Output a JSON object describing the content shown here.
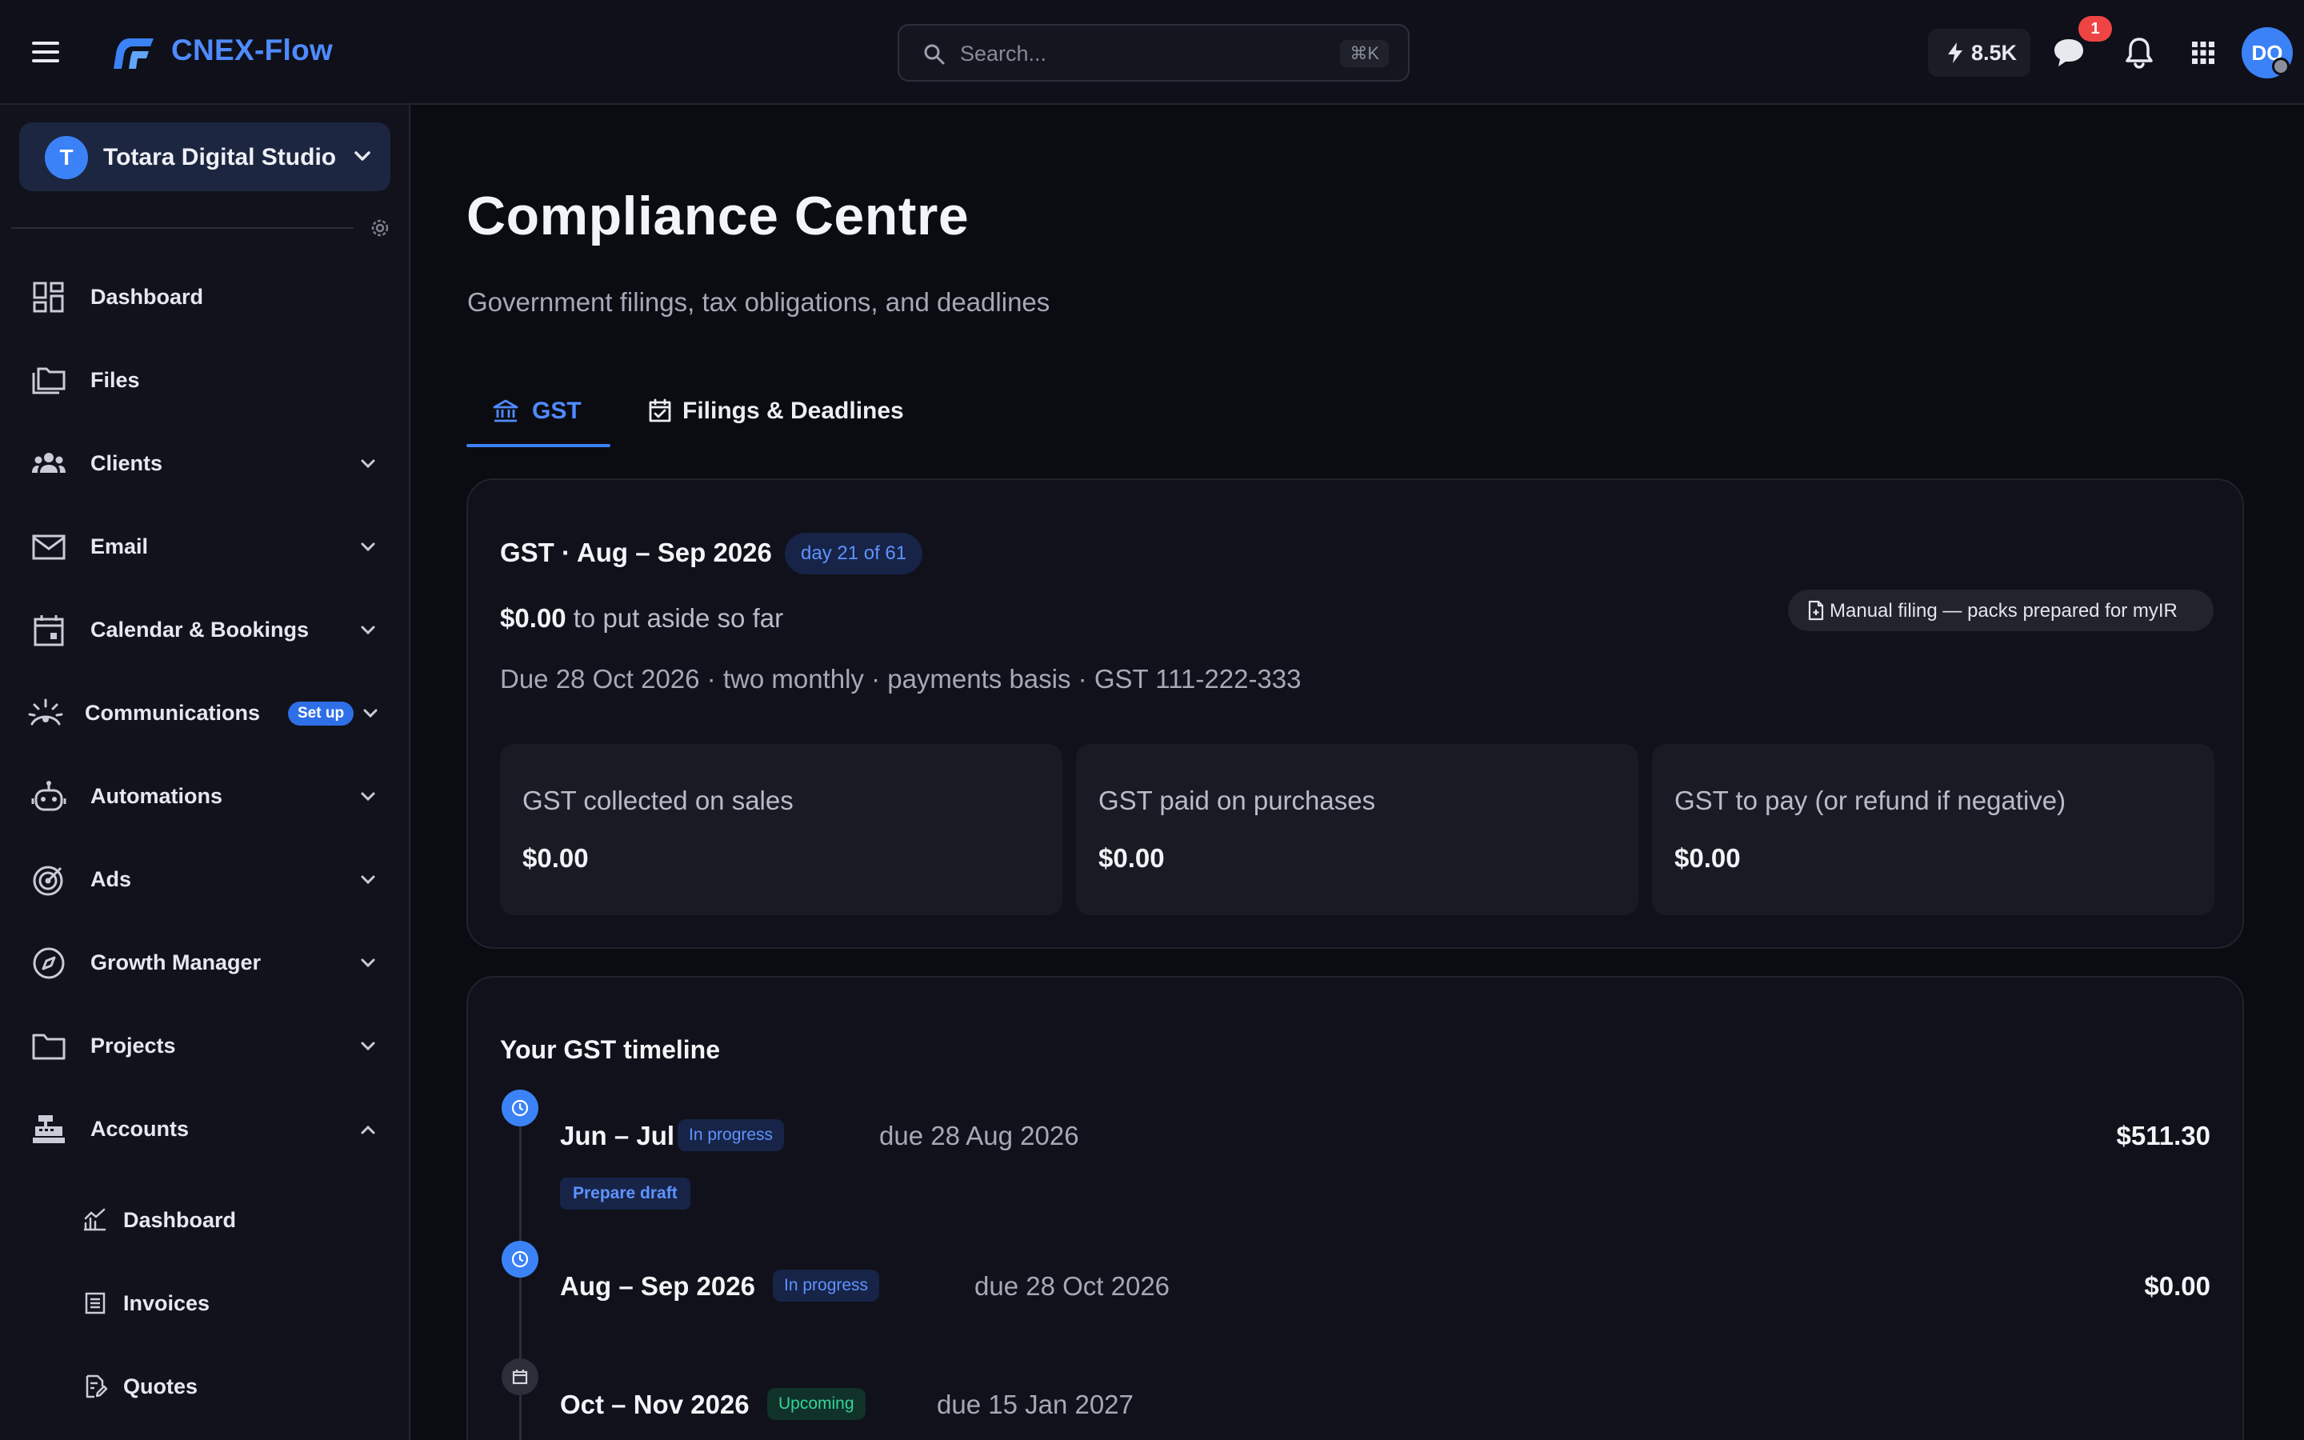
{
  "app": {
    "brand": "CNEX-Flow"
  },
  "topbar": {
    "search_placeholder": "Search...",
    "search_shortcut": "⌘K",
    "credits": "8.5K",
    "messages_badge": "1",
    "avatar_initials": "DO"
  },
  "sidebar": {
    "org_initial": "T",
    "org_name": "Totara Digital Studio",
    "items": [
      {
        "label": "Dashboard",
        "icon": "dashboard-icon"
      },
      {
        "label": "Files",
        "icon": "files-icon"
      },
      {
        "label": "Clients",
        "icon": "clients-icon"
      },
      {
        "label": "Email",
        "icon": "email-icon"
      },
      {
        "label": "Calendar & Bookings",
        "icon": "calendar-icon"
      },
      {
        "label": "Communications",
        "icon": "communications-icon",
        "badge": "Set up"
      },
      {
        "label": "Automations",
        "icon": "robot-icon"
      },
      {
        "label": "Ads",
        "icon": "target-icon"
      },
      {
        "label": "Growth Manager",
        "icon": "compass-icon"
      },
      {
        "label": "Projects",
        "icon": "folder-icon"
      },
      {
        "label": "Accounts",
        "icon": "register-icon"
      }
    ],
    "sub_items": [
      {
        "label": "Dashboard",
        "icon": "chart-icon"
      },
      {
        "label": "Invoices",
        "icon": "invoice-icon"
      },
      {
        "label": "Quotes",
        "icon": "quote-icon"
      }
    ]
  },
  "main": {
    "title": "Compliance Centre",
    "subtitle": "Government filings, tax obligations, and deadlines",
    "tabs": [
      {
        "label": "GST",
        "active": true
      },
      {
        "label": "Filings & Deadlines",
        "active": false
      }
    ],
    "gst_card": {
      "heading": "GST · Aug – Sep 2026",
      "day_badge": "day 21 of 61",
      "aside_amount": "$0.00",
      "aside_text": " to put aside so far",
      "manual_filing": "Manual filing — packs prepared for myIR",
      "due_line": "Due 28 Oct 2026 · two monthly · payments basis · GST 111-222-333",
      "stats": [
        {
          "label": "GST collected on sales",
          "value": "$0.00"
        },
        {
          "label": "GST paid on purchases",
          "value": "$0.00"
        },
        {
          "label": "GST to pay (or refund if negative)",
          "value": "$0.00"
        }
      ]
    },
    "timeline": {
      "title": "Your GST timeline",
      "entries": [
        {
          "period": "Jun – Jul 2026",
          "status": "In progress",
          "due": "due 28 Aug 2026",
          "amount": "$511.30",
          "action": "Prepare draft"
        },
        {
          "period": "Aug – Sep 2026",
          "status": "In progress",
          "due": "due 28 Oct 2026",
          "amount": "$0.00"
        },
        {
          "period": "Oct – Nov 2026",
          "status": "Upcoming",
          "due": "due 15 Jan 2027"
        }
      ]
    }
  },
  "colors": {
    "accent": "#3b82f6",
    "badge_red": "#ef4444",
    "upcoming_green": "#34d399"
  }
}
